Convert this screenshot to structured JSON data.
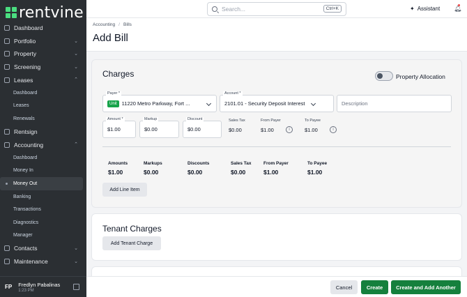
{
  "app": {
    "logo_text": "rentvine"
  },
  "colors": {
    "brand_green": "#15803d",
    "sidebar_bg": "#2b2f33",
    "accent": "#4ade80"
  },
  "sidebar": {
    "items": [
      {
        "label": "Dashboard",
        "type": "item",
        "icon": "dashboard-icon",
        "chevron": ""
      },
      {
        "label": "Portfolio",
        "type": "item",
        "icon": "folder-icon",
        "chevron": "⌄"
      },
      {
        "label": "Property",
        "type": "item",
        "icon": "home-icon",
        "chevron": "⌄"
      },
      {
        "label": "Screening",
        "type": "item",
        "icon": "screening-icon",
        "chevron": "⌄"
      },
      {
        "label": "Leases",
        "type": "item",
        "icon": "lease-icon",
        "chevron": "⌃"
      },
      {
        "label": "Dashboard",
        "type": "sub"
      },
      {
        "label": "Leases",
        "type": "sub"
      },
      {
        "label": "Renewals",
        "type": "sub"
      },
      {
        "label": "Rentsign",
        "type": "item",
        "icon": "pen-icon",
        "chevron": ""
      },
      {
        "label": "Accounting",
        "type": "item",
        "icon": "bank-icon",
        "chevron": "⌃"
      },
      {
        "label": "Dashboard",
        "type": "sub"
      },
      {
        "label": "Money In",
        "type": "sub"
      },
      {
        "label": "Money Out",
        "type": "sub",
        "active": true
      },
      {
        "label": "Banking",
        "type": "sub"
      },
      {
        "label": "Transactions",
        "type": "sub"
      },
      {
        "label": "Diagnostics",
        "type": "sub"
      },
      {
        "label": "Manager",
        "type": "sub"
      },
      {
        "label": "Contacts",
        "type": "item",
        "icon": "contacts-icon",
        "chevron": "⌄"
      },
      {
        "label": "Maintenance",
        "type": "item",
        "icon": "wrench-icon",
        "chevron": "⌄"
      }
    ],
    "user": {
      "initials": "FP",
      "name": "Fredlyn Pabalinas",
      "time": "1:23 PM"
    }
  },
  "topbar": {
    "search_placeholder": "Search...",
    "shortcut": "Ctrl+K",
    "assistant_label": "Assistant"
  },
  "header": {
    "breadcrumb": [
      "Accounting",
      "Bills"
    ],
    "title": "Add Bill"
  },
  "charges": {
    "title": "Charges",
    "toggle_label": "Property Allocation",
    "payer": {
      "label": "Payer *",
      "badge": "Unit",
      "value": "11220 Metro Parkway, Fort ..."
    },
    "account": {
      "label": "Account *",
      "value": "2101.01 - Security Deposit Interest"
    },
    "description": {
      "placeholder": "Description"
    },
    "amount": {
      "label": "Amount *",
      "value": "$1.00"
    },
    "markup": {
      "label": "Markup",
      "value": "$0.00"
    },
    "discount": {
      "label": "Discount",
      "value": "$0.00"
    },
    "sales_tax": {
      "label": "Sales Tax",
      "value": "$0.00"
    },
    "from_payer": {
      "label": "From Payer",
      "value": "$1.00"
    },
    "to_payee": {
      "label": "To Payee",
      "value": "$1.00"
    },
    "info_glyph": "i",
    "summary": [
      {
        "label": "Amounts",
        "value": "$1.00"
      },
      {
        "label": "Markups",
        "value": "$0.00"
      },
      {
        "label": "Discounts",
        "value": "$0.00"
      },
      {
        "label": "Sales Tax",
        "value": "$0.00"
      },
      {
        "label": "From Payer",
        "value": "$1.00"
      },
      {
        "label": "To Payee",
        "value": "$1.00"
      }
    ],
    "add_line_item": "Add Line Item"
  },
  "tenant_charges": {
    "title": "Tenant Charges",
    "add_button": "Add Tenant Charge"
  },
  "footer": {
    "cancel": "Cancel",
    "create": "Create",
    "create_and_add": "Create and Add Another"
  }
}
